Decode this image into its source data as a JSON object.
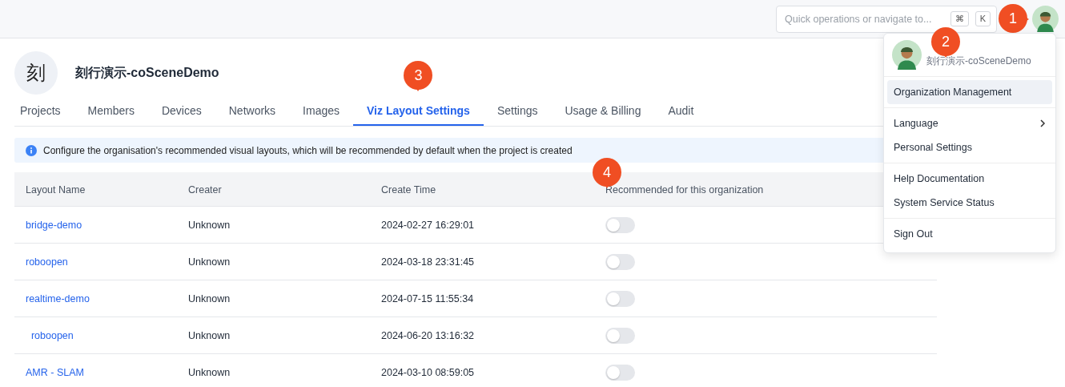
{
  "top_bar": {
    "search": {
      "placeholder": "Quick operations or navigate to...",
      "keys": [
        "⌘",
        "K"
      ]
    },
    "avatar": {
      "marker": "1"
    }
  },
  "organization": {
    "initial": "刻",
    "name": "刻行演示-coSceneDemo"
  },
  "tabs": [
    {
      "label": "Projects",
      "selected": false
    },
    {
      "label": "Members",
      "selected": false
    },
    {
      "label": "Devices",
      "selected": false
    },
    {
      "label": "Networks",
      "selected": false
    },
    {
      "label": "Images",
      "selected": false
    },
    {
      "label": "Viz Layout Settings",
      "selected": true,
      "marker": "3"
    },
    {
      "label": "Settings",
      "selected": false
    },
    {
      "label": "Usage & Billing",
      "selected": false
    },
    {
      "label": "Audit",
      "selected": false
    }
  ],
  "info_banner": "Configure the organisation's recommended visual layouts, which will be recommended by default when the project is created",
  "table": {
    "columns": [
      {
        "label": "Layout Name"
      },
      {
        "label": "Creater"
      },
      {
        "label": "Create Time"
      },
      {
        "label": "Recommended for this organization",
        "marker": "4"
      }
    ],
    "rows": [
      {
        "name": "bridge-demo",
        "creator": "Unknown",
        "time": "2024-02-27 16:29:01",
        "recommended": false
      },
      {
        "name": "roboopen",
        "creator": "Unknown",
        "time": "2024-03-18 23:31:45",
        "recommended": false
      },
      {
        "name": "realtime-demo",
        "creator": "Unknown",
        "time": "2024-07-15 11:55:34",
        "recommended": false
      },
      {
        "name": "  roboopen",
        "creator": "Unknown",
        "time": "2024-06-20 13:16:32",
        "recommended": false
      },
      {
        "name": "AMR - SLAM",
        "creator": "Unknown",
        "time": "2024-03-10 08:59:05",
        "recommended": false
      }
    ]
  },
  "user_menu": {
    "org_name": "刻行演示-coSceneDemo",
    "marker": "2",
    "groups": [
      [
        {
          "label": "Organization Management",
          "selected": true,
          "submenu": false
        }
      ],
      [
        {
          "label": "Language",
          "selected": false,
          "submenu": true
        },
        {
          "label": "Personal Settings",
          "selected": false,
          "submenu": false
        }
      ],
      [
        {
          "label": "Help Documentation",
          "selected": false,
          "submenu": false
        },
        {
          "label": "System Service Status",
          "selected": false,
          "submenu": false
        }
      ],
      [
        {
          "label": "Sign Out",
          "selected": false,
          "submenu": false
        }
      ]
    ]
  }
}
